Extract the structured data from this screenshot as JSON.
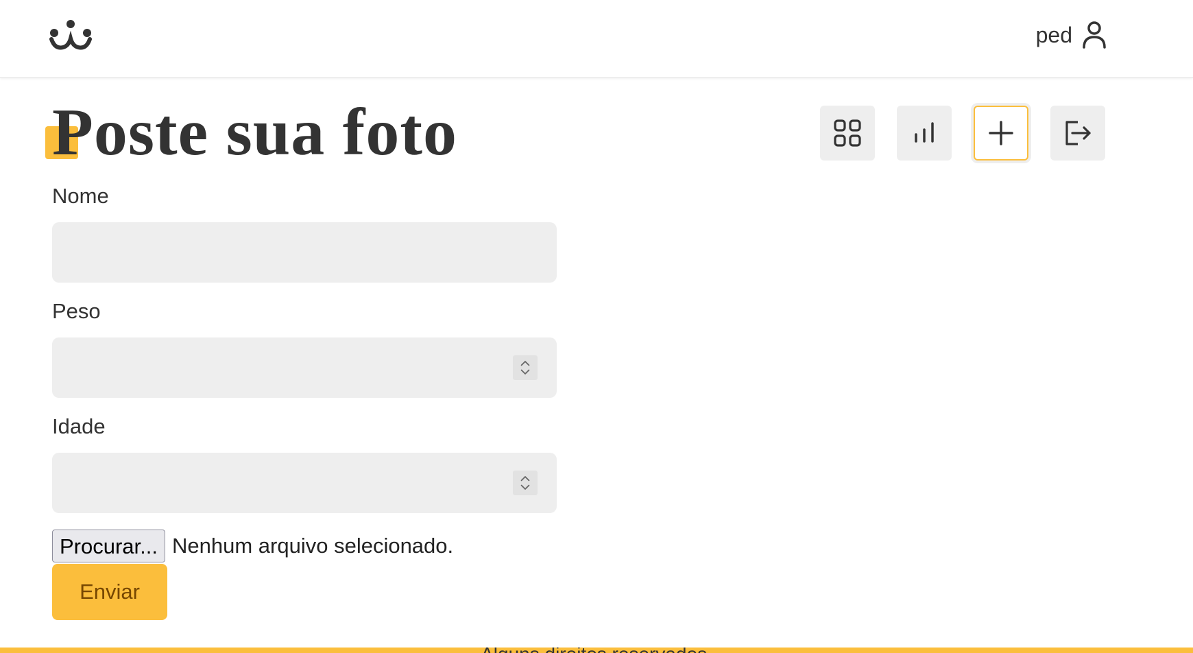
{
  "header": {
    "logo_icon": "dog-face-logo-icon",
    "username": "ped",
    "user_icon": "user-icon"
  },
  "page": {
    "title": "Poste sua foto"
  },
  "nav": [
    {
      "icon": "grid-icon",
      "active": false
    },
    {
      "icon": "bar-chart-icon",
      "active": false
    },
    {
      "icon": "plus-icon",
      "active": true
    },
    {
      "icon": "logout-icon",
      "active": false
    }
  ],
  "form": {
    "name_label": "Nome",
    "name_value": "",
    "weight_label": "Peso",
    "weight_value": "",
    "age_label": "Idade",
    "age_value": "",
    "file_button_label": "Procurar...",
    "file_status": "Nenhum arquivo selecionado.",
    "submit_label": "Enviar"
  },
  "footer": {
    "text": "Alguns direitos reservados."
  },
  "colors": {
    "accent": "#fbbe3c",
    "field_bg": "#eeeeee",
    "text": "#333333",
    "submit_text": "#764701"
  }
}
